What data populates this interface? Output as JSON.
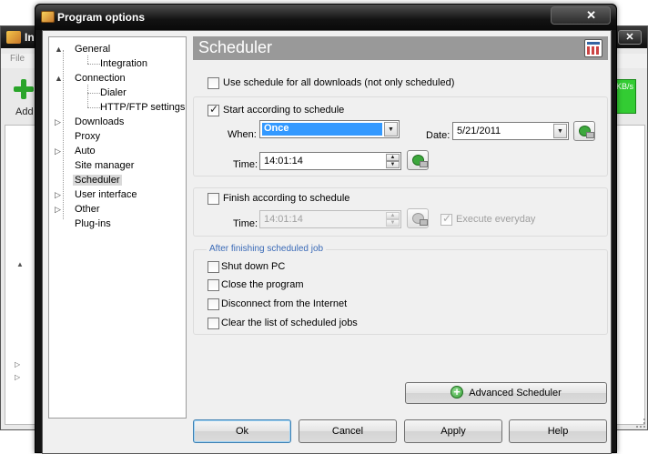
{
  "background_window": {
    "title": "In",
    "menu_label": "File",
    "add_label": "Add",
    "speed_label": "KB/s"
  },
  "dialog": {
    "title": "Program options",
    "close_label": "✕"
  },
  "tree": {
    "items": [
      {
        "label": "General",
        "toggle": "▲"
      },
      {
        "label": "Integration",
        "toggle": ""
      },
      {
        "label": "Connection",
        "toggle": "▲"
      },
      {
        "label": "Dialer",
        "toggle": ""
      },
      {
        "label": "HTTP/FTP settings",
        "toggle": ""
      },
      {
        "label": "Downloads",
        "toggle": "▷"
      },
      {
        "label": "Proxy",
        "toggle": ""
      },
      {
        "label": "Auto",
        "toggle": "▷"
      },
      {
        "label": "Site manager",
        "toggle": ""
      },
      {
        "label": "Scheduler",
        "toggle": ""
      },
      {
        "label": "User interface",
        "toggle": "▷"
      },
      {
        "label": "Other",
        "toggle": "▷"
      },
      {
        "label": "Plug-ins",
        "toggle": ""
      }
    ],
    "selected": "Scheduler"
  },
  "panel": {
    "title": "Scheduler"
  },
  "use_schedule_all": {
    "label": "Use schedule for all downloads (not only scheduled)",
    "checked": false
  },
  "start": {
    "label": "Start according to schedule",
    "checked": true,
    "when_label": "When:",
    "when_value": "Once",
    "date_label": "Date:",
    "date_value": "5/21/2011",
    "time_label": "Time:",
    "time_value": "14:01:14"
  },
  "finish": {
    "label": "Finish according to schedule",
    "checked": false,
    "time_label": "Time:",
    "time_value": "14:01:14",
    "everyday_label": "Execute everyday",
    "everyday_checked": true
  },
  "after_job": {
    "title": "After finishing scheduled job",
    "options": [
      {
        "label": "Shut down PC",
        "checked": false
      },
      {
        "label": "Close the program",
        "checked": false
      },
      {
        "label": "Disconnect from the Internet",
        "checked": false
      },
      {
        "label": "Clear the list of scheduled jobs",
        "checked": false
      }
    ]
  },
  "buttons": {
    "advanced": "Advanced Scheduler",
    "ok": "Ok",
    "cancel": "Cancel",
    "apply": "Apply",
    "help": "Help"
  },
  "colors": {
    "selection": "#3399ff",
    "header_bg": "#999999",
    "group_title": "#3a6ab7"
  }
}
